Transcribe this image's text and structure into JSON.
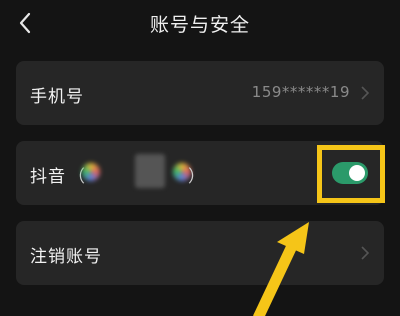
{
  "header": {
    "title": "账号与安全"
  },
  "rows": {
    "phone": {
      "label": "手机号",
      "value": "159******19"
    },
    "douyin": {
      "label": "抖音",
      "open_paren": "（",
      "close_paren": "）",
      "linked": true
    },
    "cancel": {
      "label": "注销账号"
    }
  },
  "colors": {
    "background": "#141414",
    "row": "#262626",
    "toggle_on": "#2b9a6a",
    "highlight": "#f5c518"
  },
  "icons": {
    "back": "chevron-left-icon",
    "row_chevron": "chevron-right-icon"
  }
}
